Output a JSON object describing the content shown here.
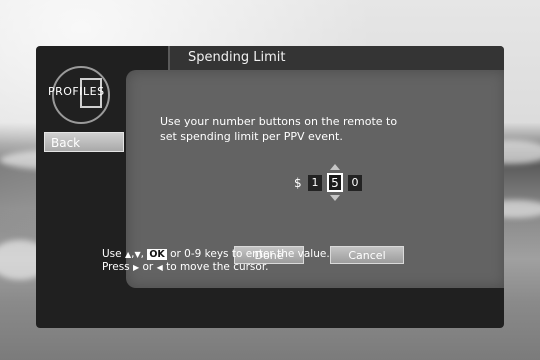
{
  "header": {
    "title": "Spending Limit"
  },
  "logo": {
    "text": "PROFILES"
  },
  "nav": {
    "back_label": "Back"
  },
  "dialog": {
    "instruction_line1": "Use your number buttons on the remote to",
    "instruction_line2": "set spending limit per PPV event.",
    "currency_symbol": "$",
    "digits": [
      "1",
      "5",
      "0"
    ],
    "selected_digit_index": 1,
    "done_label": "Done",
    "cancel_label": "Cancel"
  },
  "hint": {
    "line1_prefix": "Use",
    "up_glyph": "▲",
    "down_glyph": "▼",
    "ok_label": "OK",
    "line1_suffix": "or 0-9 keys to enter the value.",
    "line2_prefix": "Press",
    "right_glyph": "▶",
    "or_word": "or",
    "left_glyph": "◀",
    "line2_suffix": "to move the cursor."
  },
  "colors": {
    "frame": "#202020",
    "panel": "#707070",
    "button": "#b0b0b0",
    "text": "#ffffff"
  }
}
